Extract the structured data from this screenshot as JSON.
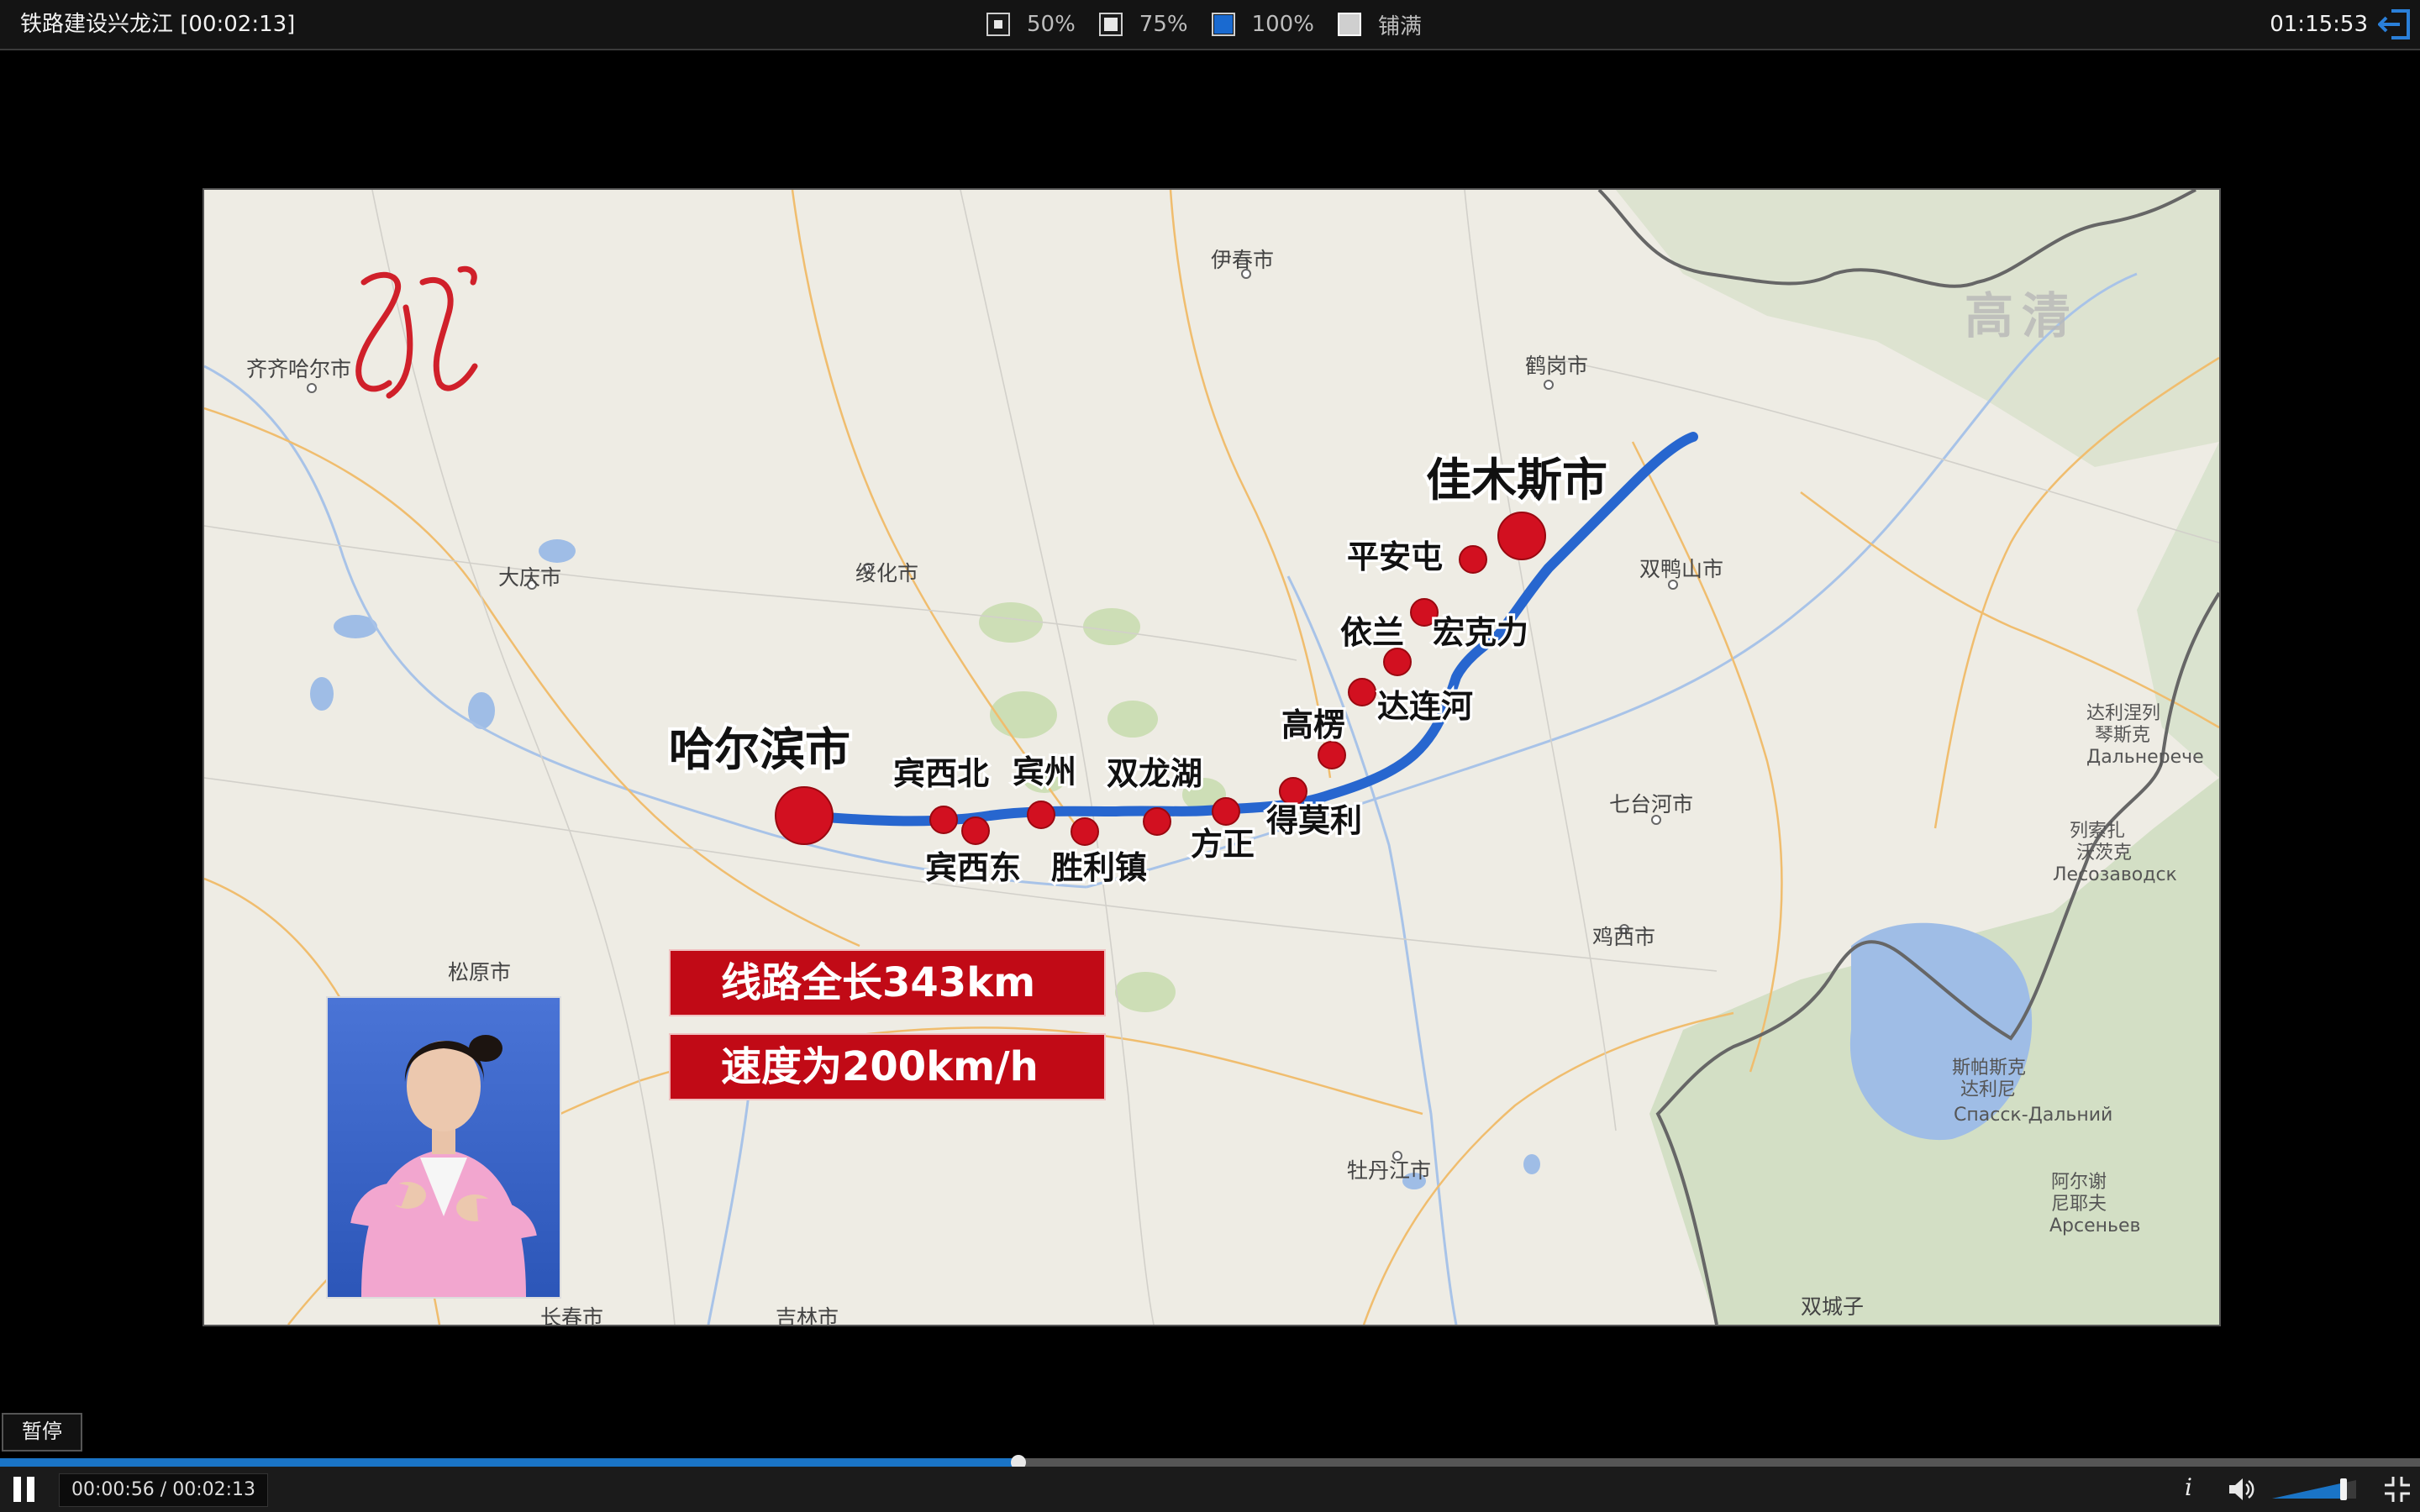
{
  "window": {
    "title": "铁路建设兴龙江 [00:02:13]",
    "clock": "01:15:53"
  },
  "zoom": {
    "options": [
      {
        "label": "50%",
        "active": false
      },
      {
        "label": "75%",
        "active": false
      },
      {
        "label": "100%",
        "active": true
      },
      {
        "label": "铺满",
        "active": false
      }
    ]
  },
  "map": {
    "watermark_quality": "高清",
    "cities": [
      "伊春市",
      "齐齐哈尔市",
      "鹤岗市",
      "大庆市",
      "绥化市",
      "双鸭山市",
      "七台河市",
      "鸡西市",
      "松原市",
      "牡丹江市",
      "长春市",
      "吉林市",
      "双城子"
    ],
    "foreign_labels": [
      "达利涅列",
      "琴斯克",
      "Дальнеречe",
      "列索扎",
      "沃茨克",
      "Лесозаводск",
      "斯帕斯克",
      "达利尼",
      "Спасск-Дальний",
      "阿尔谢",
      "尼耶夫",
      "Арсеньев"
    ],
    "terminals": [
      "哈尔滨市",
      "佳木斯市"
    ],
    "stations": [
      "宾西北",
      "宾西东",
      "宾州",
      "胜利镇",
      "双龙湖",
      "方正",
      "得莫利",
      "高楞",
      "达连河",
      "依兰",
      "宏克力",
      "平安屯"
    ],
    "info_line1": "线路全长343km",
    "info_line2": "速度为200km/h"
  },
  "player": {
    "pause_tooltip": "暂停",
    "time_display": "00:00:56 / 00:02:13",
    "progress": 0.421,
    "volume": 0.85,
    "info_label": "i",
    "accent": "#1a74c6"
  }
}
